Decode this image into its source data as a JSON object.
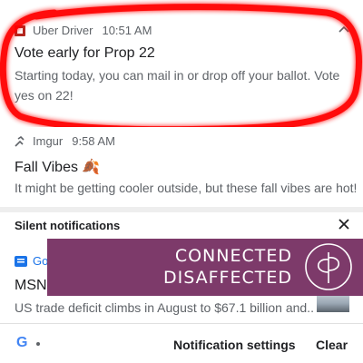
{
  "notifications": [
    {
      "app": "Uber Driver",
      "time": "10:51 AM",
      "title": "Vote early for Prop 22",
      "body": "Starting today, you can mail in or drop off your ballot. Vote yes on 22!",
      "icon": "uber-icon",
      "expand_icon": "chevron-up-icon"
    },
    {
      "app": "Imgur",
      "time": "9:58 AM",
      "title": "Fall Vibes",
      "title_emoji": "🍂",
      "body": "It might be getting cooler outside, but these fall vibes are hot!",
      "icon": "imgur-icon"
    }
  ],
  "silent": {
    "label": "Silent notifications",
    "close_icon": "close-icon",
    "item": {
      "app": "Go",
      "title": "MSN",
      "body": "US trade deficit climbs in August to $67.1 billion and..",
      "icon": "google-news-icon"
    }
  },
  "banner": {
    "line1": "CONNECTED",
    "line2": "DISAFFECTED",
    "color": "#7d3a6a",
    "logo_icon": "connected-disaffected-logo"
  },
  "footer": {
    "logo": "G",
    "settings": "Notification settings",
    "clear": "Clear"
  },
  "colors": {
    "scribble": "#ff0000",
    "accent": "#1a73e8"
  }
}
